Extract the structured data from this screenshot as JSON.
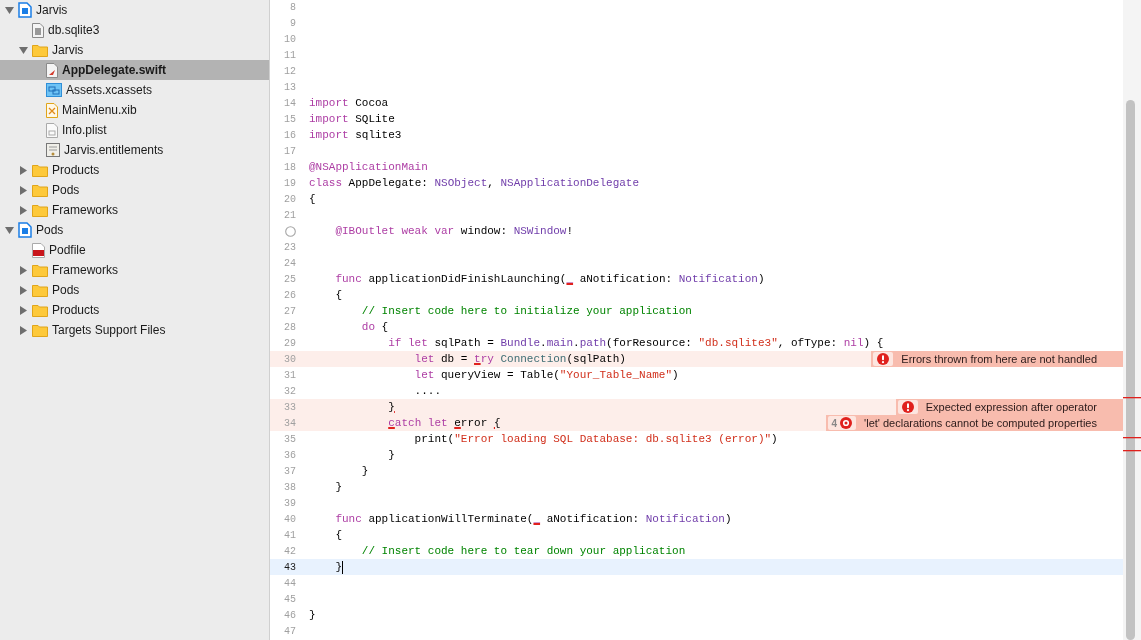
{
  "navigator": {
    "items": [
      {
        "label": "Jarvis",
        "kind": "project",
        "expanded": true,
        "selected": false,
        "children": [
          {
            "label": "db.sqlite3",
            "kind": "file",
            "selected": false
          },
          {
            "label": "Jarvis",
            "kind": "folder",
            "expanded": true,
            "selected": false,
            "children": [
              {
                "label": "AppDelegate.swift",
                "kind": "swift",
                "selected": true
              },
              {
                "label": "Assets.xcassets",
                "kind": "assets",
                "selected": false
              },
              {
                "label": "MainMenu.xib",
                "kind": "xib",
                "selected": false
              },
              {
                "label": "Info.plist",
                "kind": "plist",
                "selected": false
              },
              {
                "label": "Jarvis.entitlements",
                "kind": "entitlements",
                "selected": false
              }
            ]
          },
          {
            "label": "Products",
            "kind": "folder",
            "expanded": false,
            "selected": false
          },
          {
            "label": "Pods",
            "kind": "folder",
            "expanded": false,
            "selected": false
          },
          {
            "label": "Frameworks",
            "kind": "folder",
            "expanded": false,
            "selected": false
          }
        ]
      },
      {
        "label": "Pods",
        "kind": "project",
        "expanded": true,
        "selected": false,
        "children": [
          {
            "label": "Podfile",
            "kind": "ruby",
            "selected": false
          },
          {
            "label": "Frameworks",
            "kind": "folder",
            "expanded": false,
            "selected": false
          },
          {
            "label": "Pods",
            "kind": "folder",
            "expanded": false,
            "selected": false
          },
          {
            "label": "Products",
            "kind": "folder",
            "expanded": false,
            "selected": false
          },
          {
            "label": "Targets Support Files",
            "kind": "folder",
            "expanded": false,
            "selected": false
          }
        ]
      }
    ]
  },
  "editor": {
    "lines": [
      {
        "number": "8",
        "kind": "normal"
      },
      {
        "number": "9",
        "kind": "normal"
      },
      {
        "number": "10",
        "kind": "normal"
      },
      {
        "number": "11",
        "kind": "normal"
      },
      {
        "number": "12",
        "kind": "normal"
      },
      {
        "number": "13",
        "kind": "normal"
      },
      {
        "number": "14",
        "kind": "normal",
        "tokens": [
          {
            "text": "import",
            "kind": "kw"
          },
          {
            "text": " Cocoa",
            "kind": "plain"
          }
        ]
      },
      {
        "number": "15",
        "kind": "normal",
        "tokens": [
          {
            "text": "import",
            "kind": "kw"
          },
          {
            "text": " SQLite",
            "kind": "plain"
          }
        ]
      },
      {
        "number": "16",
        "kind": "normal",
        "tokens": [
          {
            "text": "import",
            "kind": "kw"
          },
          {
            "text": " sqlite3",
            "kind": "plain"
          }
        ]
      },
      {
        "number": "17",
        "kind": "normal"
      },
      {
        "number": "18",
        "kind": "normal",
        "tokens": [
          {
            "text": "@NSApplicationMain",
            "kind": "kw"
          }
        ]
      },
      {
        "number": "19",
        "kind": "normal",
        "tokens": [
          {
            "text": "class",
            "kind": "kw"
          },
          {
            "text": " AppDelegate: ",
            "kind": "plain"
          },
          {
            "text": "NSObject",
            "kind": "type"
          },
          {
            "text": ", ",
            "kind": "plain"
          },
          {
            "text": "NSApplicationDelegate",
            "kind": "type"
          }
        ]
      },
      {
        "number": "20",
        "kind": "normal",
        "tokens": [
          {
            "text": "{",
            "kind": "plain"
          }
        ]
      },
      {
        "number": "21",
        "kind": "normal"
      },
      {
        "outlet_connected": false,
        "kind": "normal",
        "tokens": [
          {
            "text": "    @IBOutlet weak var",
            "kind": "kw"
          },
          {
            "text": " window: ",
            "kind": "plain"
          },
          {
            "text": "NSWindow",
            "kind": "type"
          },
          {
            "text": "!",
            "kind": "plain"
          }
        ]
      },
      {
        "number": "23",
        "kind": "normal"
      },
      {
        "number": "24",
        "kind": "normal"
      },
      {
        "number": "25",
        "kind": "normal",
        "tokens": [
          {
            "text": "    func",
            "kind": "kw"
          },
          {
            "text": " applicationDidFinishLaunching(",
            "kind": "plain"
          },
          {
            "text": "_",
            "kind": "kw_u"
          },
          {
            "text": " aNotification: ",
            "kind": "plain"
          },
          {
            "text": "Notification",
            "kind": "type"
          },
          {
            "text": ")",
            "kind": "plain"
          }
        ]
      },
      {
        "number": "26",
        "kind": "normal",
        "tokens": [
          {
            "text": "    {",
            "kind": "plain"
          }
        ]
      },
      {
        "number": "27",
        "kind": "normal",
        "tokens": [
          {
            "text": "        // Insert code here to initialize your application",
            "kind": "comment"
          }
        ]
      },
      {
        "number": "28",
        "kind": "normal",
        "tokens": [
          {
            "text": "        do",
            "kind": "kw"
          },
          {
            "text": " {",
            "kind": "plain"
          }
        ]
      },
      {
        "number": "29",
        "kind": "normal",
        "tokens": [
          {
            "text": "            if let",
            "kind": "kw"
          },
          {
            "text": " sqlPath = ",
            "kind": "plain"
          },
          {
            "text": "Bundle",
            "kind": "type"
          },
          {
            "text": ".",
            "kind": "plain"
          },
          {
            "text": "main",
            "kind": "type"
          },
          {
            "text": ".",
            "kind": "plain"
          },
          {
            "text": "path",
            "kind": "type"
          },
          {
            "text": "(forResource: ",
            "kind": "plain"
          },
          {
            "text": "\"db.sqlite3\"",
            "kind": "str"
          },
          {
            "text": ", ofType: ",
            "kind": "plain"
          },
          {
            "text": "nil",
            "kind": "kw"
          },
          {
            "text": ") {",
            "kind": "plain"
          }
        ]
      },
      {
        "number": "30",
        "kind": "error",
        "tokens": [
          {
            "text": "                let",
            "kind": "kw"
          },
          {
            "text": " db = ",
            "kind": "plain"
          },
          {
            "text": "t",
            "kind": "kw_u"
          },
          {
            "text": "ry",
            "kind": "kw"
          },
          {
            "text": " Connection",
            "kind": "cls"
          },
          {
            "text": "(sqlPath)",
            "kind": "plain"
          }
        ],
        "issue": {
          "kind": "exclamation",
          "message": "Errors thrown from here are not handled"
        }
      },
      {
        "number": "31",
        "kind": "normal",
        "tokens": [
          {
            "text": "                let",
            "kind": "kw"
          },
          {
            "text": " queryView = Table(",
            "kind": "plain"
          },
          {
            "text": "\"Your_Table_Name\"",
            "kind": "str"
          },
          {
            "text": ")",
            "kind": "plain"
          }
        ]
      },
      {
        "number": "32",
        "kind": "normal",
        "tokens": [
          {
            "text": "                ....",
            "kind": "plain"
          }
        ]
      },
      {
        "number": "33",
        "kind": "error",
        "tokens": [
          {
            "text": "            }",
            "kind": "plain_u"
          }
        ],
        "issue": {
          "kind": "exclamation",
          "message": "Expected expression after operator"
        }
      },
      {
        "number": "34",
        "kind": "error",
        "tokens": [
          {
            "text": "            c",
            "kind": "kw_u"
          },
          {
            "text": "atch let",
            "kind": "kw"
          },
          {
            "text": " e",
            "kind": "plain_u"
          },
          {
            "text": "rror ",
            "kind": "plain"
          },
          {
            "text": "{",
            "kind": "plain_u"
          }
        ],
        "issue": {
          "kind": "ring",
          "count": "4",
          "message": "'let' declarations cannot be computed properties"
        }
      },
      {
        "number": "35",
        "kind": "normal",
        "tokens": [
          {
            "text": "                print(",
            "kind": "plain"
          },
          {
            "text": "\"Error loading SQL Database: db.sqlite3 (error)\"",
            "kind": "str"
          },
          {
            "text": ")",
            "kind": "plain"
          }
        ]
      },
      {
        "number": "36",
        "kind": "normal",
        "tokens": [
          {
            "text": "            }",
            "kind": "plain"
          }
        ]
      },
      {
        "number": "37",
        "kind": "normal",
        "tokens": [
          {
            "text": "        }",
            "kind": "plain"
          }
        ]
      },
      {
        "number": "38",
        "kind": "normal",
        "tokens": [
          {
            "text": "    }",
            "kind": "plain"
          }
        ]
      },
      {
        "number": "39",
        "kind": "normal"
      },
      {
        "number": "40",
        "kind": "normal",
        "tokens": [
          {
            "text": "    func",
            "kind": "kw"
          },
          {
            "text": " applicationWillTerminate(",
            "kind": "plain"
          },
          {
            "text": "_",
            "kind": "kw_u"
          },
          {
            "text": " aNotification: ",
            "kind": "plain"
          },
          {
            "text": "Notification",
            "kind": "type"
          },
          {
            "text": ")",
            "kind": "plain"
          }
        ]
      },
      {
        "number": "41",
        "kind": "normal",
        "tokens": [
          {
            "text": "    {",
            "kind": "plain"
          }
        ]
      },
      {
        "number": "42",
        "kind": "normal",
        "tokens": [
          {
            "text": "        // Insert code here to tear down your application",
            "kind": "comment"
          }
        ]
      },
      {
        "number": "43",
        "kind": "current",
        "tokens": [
          {
            "text": "    }",
            "kind": "plain"
          }
        ]
      },
      {
        "number": "44",
        "kind": "normal"
      },
      {
        "number": "45",
        "kind": "normal"
      },
      {
        "number": "46",
        "kind": "normal",
        "tokens": [
          {
            "text": "}",
            "kind": "plain"
          }
        ]
      },
      {
        "number": "47",
        "kind": "normal"
      }
    ]
  }
}
